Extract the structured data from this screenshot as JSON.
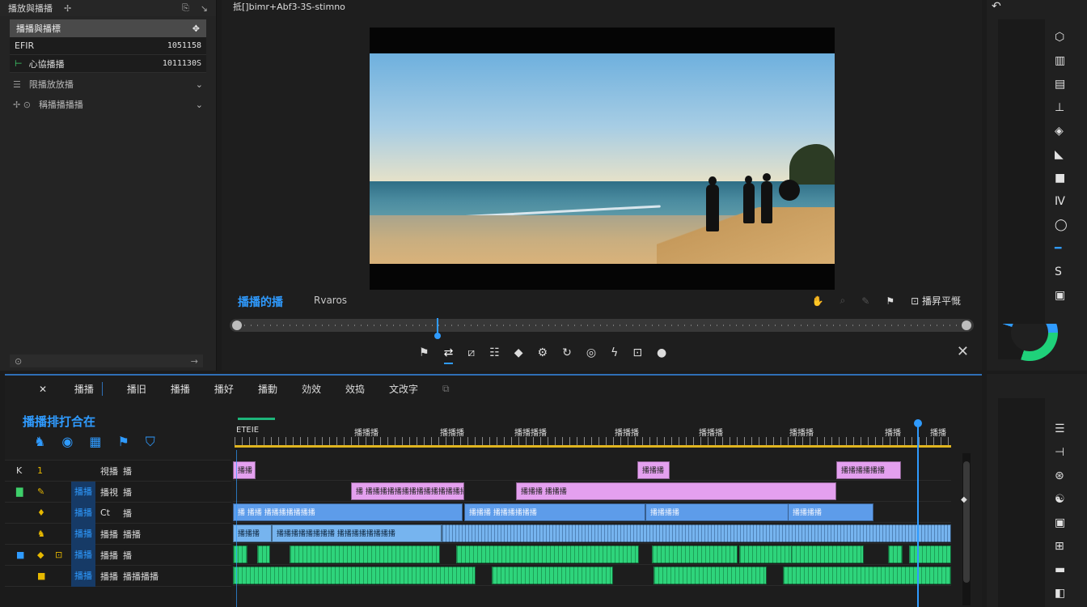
{
  "left_panel": {
    "title": "播放與播播",
    "header_icons": [
      "pin-icon",
      "export-icon",
      "arrow-icon"
    ],
    "selected_item": "播播與播標",
    "rows": [
      {
        "label": "EFIR",
        "value": "1051158"
      },
      {
        "label": "心協播播",
        "value": "1011130S"
      }
    ],
    "folders": [
      {
        "label": "限播放放播"
      },
      {
        "label": "稱播播播播"
      }
    ]
  },
  "monitor": {
    "title": "抵[]bimr+Abf3-3S-stimno",
    "label_left": "播播的播",
    "label_right": "Rvaros",
    "right_label": "播昇平慨",
    "transport_icons": [
      "marker-icon",
      "trim-icon",
      "crop-icon",
      "text-icon",
      "drop-icon",
      "mask-icon",
      "rotate-icon",
      "circle-icon",
      "lightning-icon",
      "export-frame-icon",
      "comment-icon"
    ]
  },
  "timeline": {
    "tabs": [
      "播播",
      "播旧",
      "播播",
      "播好",
      "播動",
      "効效",
      "效捣",
      "文改字"
    ],
    "title": "播播排打合在",
    "ruler_labels": [
      {
        "text": "ETEIE"
      },
      {
        "text": "播播播"
      },
      {
        "text": "播播播"
      },
      {
        "text": "播播播播"
      },
      {
        "text": "播播播"
      },
      {
        "text": "播播播"
      },
      {
        "text": "播播播"
      },
      {
        "text": "播播"
      },
      {
        "text": "播播"
      }
    ],
    "tracks": [
      {
        "head": [
          "K",
          "1",
          "",
          "",
          "視播",
          "播"
        ],
        "clips": [
          {
            "cls": "pink",
            "label": "播播"
          },
          {
            "cls": "pink",
            "label": "播播播"
          },
          {
            "cls": "pink",
            "label": "播播播播播播"
          }
        ]
      },
      {
        "head": [
          "",
          "",
          "",
          "播播",
          "播視",
          "播"
        ],
        "clips": [
          {
            "cls": "pink",
            "label": "播 播播播播播播播播播播播播播播播"
          },
          {
            "cls": "pink",
            "label": "播播播              播播播"
          }
        ]
      },
      {
        "head": [
          "",
          "",
          "",
          "播播",
          "Ct",
          "播"
        ],
        "clips": [
          {
            "cls": "blue",
            "label": "播 播播 播播播播播播播"
          },
          {
            "cls": "blue",
            "label": "播播播 播播播播播播"
          },
          {
            "cls": "blue",
            "label": "播播播播"
          },
          {
            "cls": "blue",
            "label": "播播播播"
          }
        ]
      },
      {
        "head": [
          "",
          "",
          "",
          "播播",
          "播播",
          "播播"
        ],
        "clips": [
          {
            "cls": "lblue",
            "label": "播播播"
          },
          {
            "cls": "lblue",
            "label": "播播播播播播播播 播播播播播播播播"
          },
          {
            "cls": "wave-b",
            "label": ""
          }
        ]
      },
      {
        "head": [
          "",
          "",
          "",
          "播播",
          "播播",
          "播"
        ],
        "clips": [
          {
            "cls": "green",
            "label": ""
          },
          {
            "cls": "green",
            "label": ""
          },
          {
            "cls": "green",
            "label": ""
          },
          {
            "cls": "green",
            "label": ""
          },
          {
            "cls": "green",
            "label": ""
          },
          {
            "cls": "green",
            "label": ""
          },
          {
            "cls": "green",
            "label": ""
          },
          {
            "cls": "green",
            "label": ""
          },
          {
            "cls": "green",
            "label": ""
          }
        ]
      },
      {
        "head": [
          "",
          "",
          "",
          "播播",
          "播播",
          "播播播播"
        ],
        "clips": [
          {
            "cls": "green",
            "label": ""
          },
          {
            "cls": "green",
            "label": ""
          },
          {
            "cls": "green",
            "label": ""
          },
          {
            "cls": "green",
            "label": ""
          },
          {
            "cls": "green",
            "label": ""
          }
        ]
      }
    ]
  },
  "colors": {
    "accent": "#2f9bff",
    "clip_pink": "#e4a0ef",
    "clip_blue": "#5d9cea",
    "clip_green": "#2ed47b",
    "ruler": "#e0b520"
  }
}
